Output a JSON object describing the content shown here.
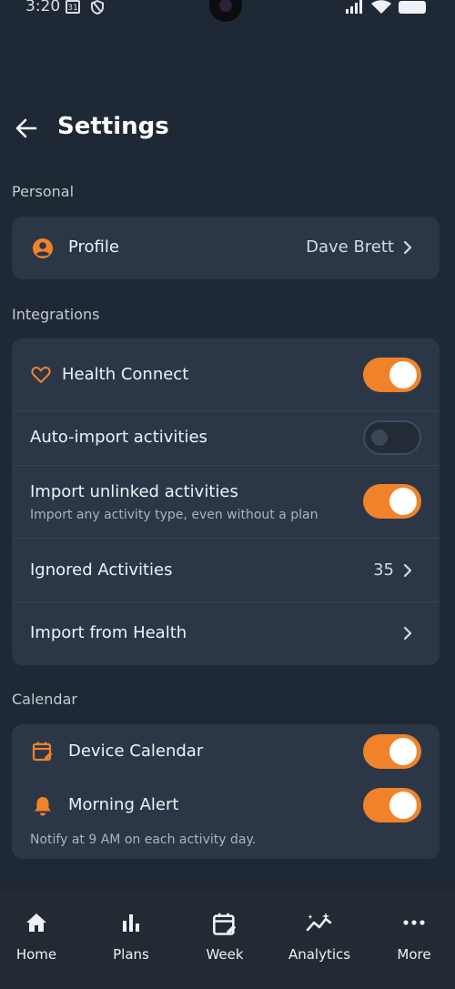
{
  "status": {
    "time": "3:20",
    "cal_day": "31"
  },
  "header": {
    "title": "Settings"
  },
  "personal": {
    "label": "Personal",
    "profile": {
      "label": "Profile",
      "value": "Dave Brett"
    }
  },
  "integrations": {
    "label": "Integrations",
    "health_connect": {
      "label": "Health Connect",
      "enabled": true
    },
    "auto_import": {
      "label": "Auto-import activities",
      "enabled": false
    },
    "import_unlinked": {
      "label": "Import unlinked activities",
      "sublabel": "Import any activity type, even without a plan",
      "enabled": true
    },
    "ignored": {
      "label": "Ignored Activities",
      "value": "35"
    },
    "import_health": {
      "label": "Import from Health"
    }
  },
  "calendar": {
    "label": "Calendar",
    "device_calendar": {
      "label": "Device Calendar",
      "enabled": true
    },
    "morning_alert": {
      "label": "Morning Alert",
      "enabled": true,
      "note": "Notify at 9 AM on each activity day."
    }
  },
  "nav": {
    "items": [
      {
        "label": "Home",
        "icon": "home-icon"
      },
      {
        "label": "Plans",
        "icon": "bar-chart-icon"
      },
      {
        "label": "Week",
        "icon": "calendar-edit-icon"
      },
      {
        "label": "Analytics",
        "icon": "analytics-icon"
      },
      {
        "label": "More",
        "icon": "more-icon"
      }
    ]
  },
  "colors": {
    "accent": "#f0822a",
    "background": "#1f2935",
    "card": "#2b3746"
  }
}
